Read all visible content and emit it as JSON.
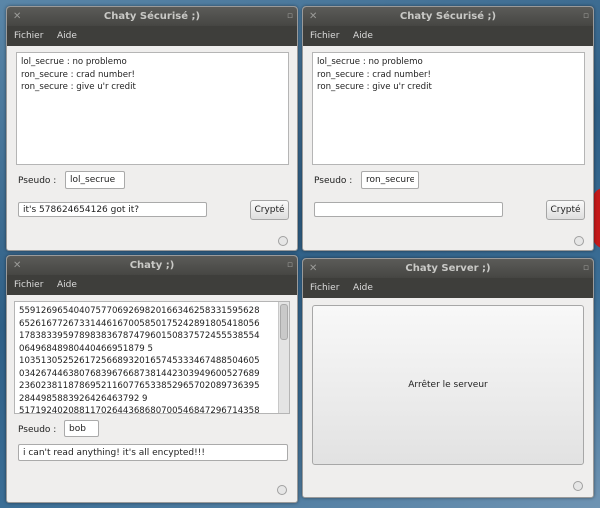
{
  "windows": {
    "w1": {
      "title": "Chaty Sécurisé ;)",
      "menu": [
        "Fichier",
        "Aide"
      ],
      "messages": [
        "lol_secrue : no problemo",
        "ron_secure : crad number!",
        "ron_secure : give u'r credit"
      ],
      "pseudo_label": "Pseudo :",
      "pseudo_value": "lol_secrue",
      "input_value": "it's 578624654126 got it?",
      "send_label": "Crypté"
    },
    "w2": {
      "title": "Chaty Sécurisé ;)",
      "menu": [
        "Fichier",
        "Aide"
      ],
      "messages": [
        "lol_secrue : no problemo",
        "ron_secure : crad number!",
        "ron_secure : give u'r credit"
      ],
      "pseudo_label": "Pseudo :",
      "pseudo_value": "ron_secure",
      "input_value": "",
      "send_label": "Crypté"
    },
    "w3": {
      "title": "Chaty ;)",
      "menu": [
        "Fichier",
        "Aide"
      ],
      "messages": [
        "5591269654040757706926982016634625833159562​8",
        "65261677267331446167005850175242891805418056",
        "17838339597898383678747960150837572455538554",
        "06496848980440466951879 5",
        "10351305252617256689320165745333467488504605",
        "03426744638076839676687381442303949600527689",
        "23602381187869521160776533852965702089736395",
        "2844985883926426463792 9",
        "51719240208811702644368680700546847296714358"
      ],
      "pseudo_label": "Pseudo :",
      "pseudo_value": "bob",
      "input_value": "i can't read anything! it's all encypted!!!"
    },
    "w4": {
      "title": "Chaty Server ;)",
      "menu": [
        "Fichier",
        "Aide"
      ],
      "button_label": "Arrêter le serveur"
    }
  },
  "icons": {
    "close": "close-icon",
    "maximize": "maximize-icon",
    "resize": "resize-grip-icon"
  }
}
